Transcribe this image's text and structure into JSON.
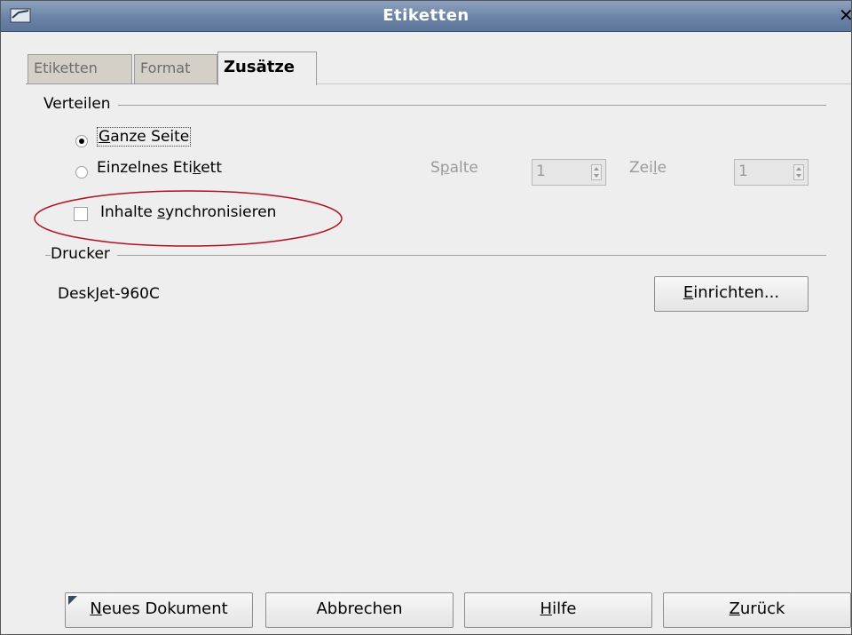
{
  "window": {
    "title": "Etiketten",
    "close_label": "✕"
  },
  "tabs": [
    {
      "label": "Etiketten",
      "active": false
    },
    {
      "label": "Format",
      "active": false
    },
    {
      "label": "Zusätze",
      "active": true
    }
  ],
  "verteilen": {
    "heading": "Verteilen",
    "option_full_page": {
      "label": "Ganze Seite",
      "mnemonic": "G",
      "checked": true
    },
    "option_single_label": {
      "label_before": "Einzelnes Eti",
      "mnemonic": "k",
      "label_after": "ett",
      "checked": false
    },
    "column": {
      "label_before": "S",
      "mnemonic": "p",
      "label_after": "alte",
      "value": "1"
    },
    "row": {
      "label_before": "Zei",
      "mnemonic": "l",
      "label_after": "e",
      "value": "1"
    },
    "sync": {
      "label_before": "Inhalte ",
      "mnemonic": "s",
      "label_after": "ynchronisieren",
      "checked": false
    }
  },
  "drucker": {
    "heading": "Drucker",
    "printer_name": "DeskJet-960C",
    "setup_button": {
      "mnemonic": "E",
      "rest": "inrichten..."
    }
  },
  "buttons": {
    "new_document": {
      "mnemonic": "N",
      "rest": "eues Dokument"
    },
    "cancel": "Abbrechen",
    "help": {
      "mnemonic": "H",
      "rest": "ilfe"
    },
    "back": {
      "mnemonic": "Z",
      "rest": "urück"
    }
  },
  "colors": {
    "titlebar": "#6b83a6",
    "dialog_bg": "#eeeeee",
    "annotation": "#b01020"
  }
}
